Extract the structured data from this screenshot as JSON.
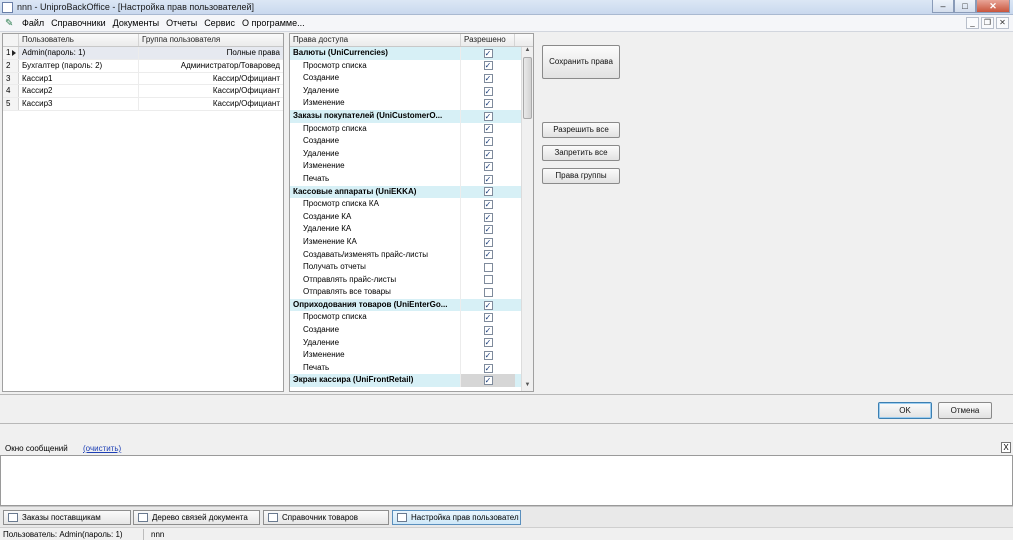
{
  "window": {
    "title": "nnn - UniproBackOffice  - [Настройка прав пользователей]"
  },
  "menu": {
    "items": [
      "Файл",
      "Справочники",
      "Документы",
      "Отчеты",
      "Сервис",
      "О программе..."
    ]
  },
  "users_table": {
    "headers": {
      "user": "Пользователь",
      "group": "Группа пользователя"
    },
    "rows": [
      {
        "num": "1",
        "user": "Admin(пароль: 1)",
        "group": "Полные права"
      },
      {
        "num": "2",
        "user": "Бухгалтер (пароль: 2)",
        "group": "Администратор/Товаровед"
      },
      {
        "num": "3",
        "user": "Кассир1",
        "group": "Кассир/Официант"
      },
      {
        "num": "4",
        "user": "Кассир2",
        "group": "Кассир/Официант"
      },
      {
        "num": "5",
        "user": "Кассир3",
        "group": "Кассир/Официант"
      }
    ]
  },
  "rights_table": {
    "headers": {
      "right": "Права доступа",
      "allowed": "Разрешено"
    },
    "rows": [
      {
        "name": "Валюты (UniCurrencies)",
        "group": true,
        "checked": true
      },
      {
        "name": "Просмотр списка",
        "group": false,
        "checked": true
      },
      {
        "name": "Создание",
        "group": false,
        "checked": true
      },
      {
        "name": "Удаление",
        "group": false,
        "checked": true
      },
      {
        "name": "Изменение",
        "group": false,
        "checked": true
      },
      {
        "name": "Заказы покупателей (UniCustomerO...",
        "group": true,
        "checked": true
      },
      {
        "name": "Просмотр списка",
        "group": false,
        "checked": true
      },
      {
        "name": "Создание",
        "group": false,
        "checked": true
      },
      {
        "name": "Удаление",
        "group": false,
        "checked": true
      },
      {
        "name": "Изменение",
        "group": false,
        "checked": true
      },
      {
        "name": "Печать",
        "group": false,
        "checked": true
      },
      {
        "name": "Кассовые аппараты (UniEKKA)",
        "group": true,
        "checked": true
      },
      {
        "name": "Просмотр списка КА",
        "group": false,
        "checked": true
      },
      {
        "name": "Создание КА",
        "group": false,
        "checked": true
      },
      {
        "name": "Удаление КА",
        "group": false,
        "checked": true
      },
      {
        "name": "Изменение КА",
        "group": false,
        "checked": true
      },
      {
        "name": "Создавать/изменять прайс-листы",
        "group": false,
        "checked": true
      },
      {
        "name": "Получать отчеты",
        "group": false,
        "checked": false
      },
      {
        "name": "Отправлять прайс-листы",
        "group": false,
        "checked": false
      },
      {
        "name": "Отправлять все товары",
        "group": false,
        "checked": false
      },
      {
        "name": "Оприходования товаров (UniEnterGo...",
        "group": true,
        "checked": true
      },
      {
        "name": "Просмотр списка",
        "group": false,
        "checked": true
      },
      {
        "name": "Создание",
        "group": false,
        "checked": true
      },
      {
        "name": "Удаление",
        "group": false,
        "checked": true
      },
      {
        "name": "Изменение",
        "group": false,
        "checked": true
      },
      {
        "name": "Печать",
        "group": false,
        "checked": true
      },
      {
        "name": "Экран кассира (UniFrontRetail)",
        "group": true,
        "checked": true
      }
    ]
  },
  "buttons": {
    "save": "Сохранить права",
    "allow_all": "Разрешить все",
    "deny_all": "Запретить все",
    "group_rights": "Права группы",
    "ok": "OK",
    "cancel": "Отмена"
  },
  "messages": {
    "title": "Окно сообщений",
    "clear": "(очистить)",
    "close": "X"
  },
  "tabs": [
    {
      "label": "Заказы поставщикам",
      "active": false
    },
    {
      "label": "Дерево связей документа",
      "active": false
    },
    {
      "label": "Справочник товаров",
      "active": false
    },
    {
      "label": "Настройка прав пользовател",
      "active": true
    }
  ],
  "status": {
    "user": "Пользователь: Admin(пароль: 1)",
    "db": "nnn"
  }
}
